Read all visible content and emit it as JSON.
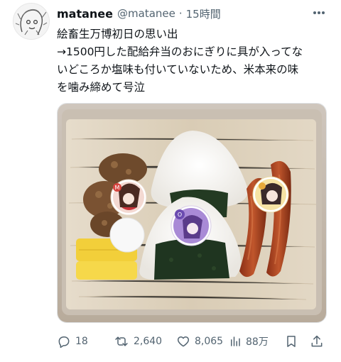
{
  "tweet": {
    "display_name": "matanee",
    "handle": "@matanee",
    "separator": "·",
    "time": "15時間",
    "text_lines": [
      "絵畜生万博初日の思い出",
      "→1500円した配給弁当のおにぎりに具が入ってな",
      "いどころか塩味も付いていないため、米本来の味",
      "を噛み締めて号泣"
    ],
    "media_description_icons": [
      "bento-photo"
    ],
    "sticker_letters": [
      "M",
      "O"
    ]
  },
  "actions": {
    "reply_count": "18",
    "retweet_count": "2,640",
    "like_count": "8,065",
    "views_count": "88万"
  },
  "icons": {
    "more": "more-icon",
    "reply": "reply-icon",
    "retweet": "retweet-icon",
    "like": "heart-icon",
    "views": "views-icon",
    "bookmark": "bookmark-icon",
    "share": "share-icon"
  },
  "colors": {
    "text_primary": "#0f1419",
    "text_secondary": "#536471"
  }
}
